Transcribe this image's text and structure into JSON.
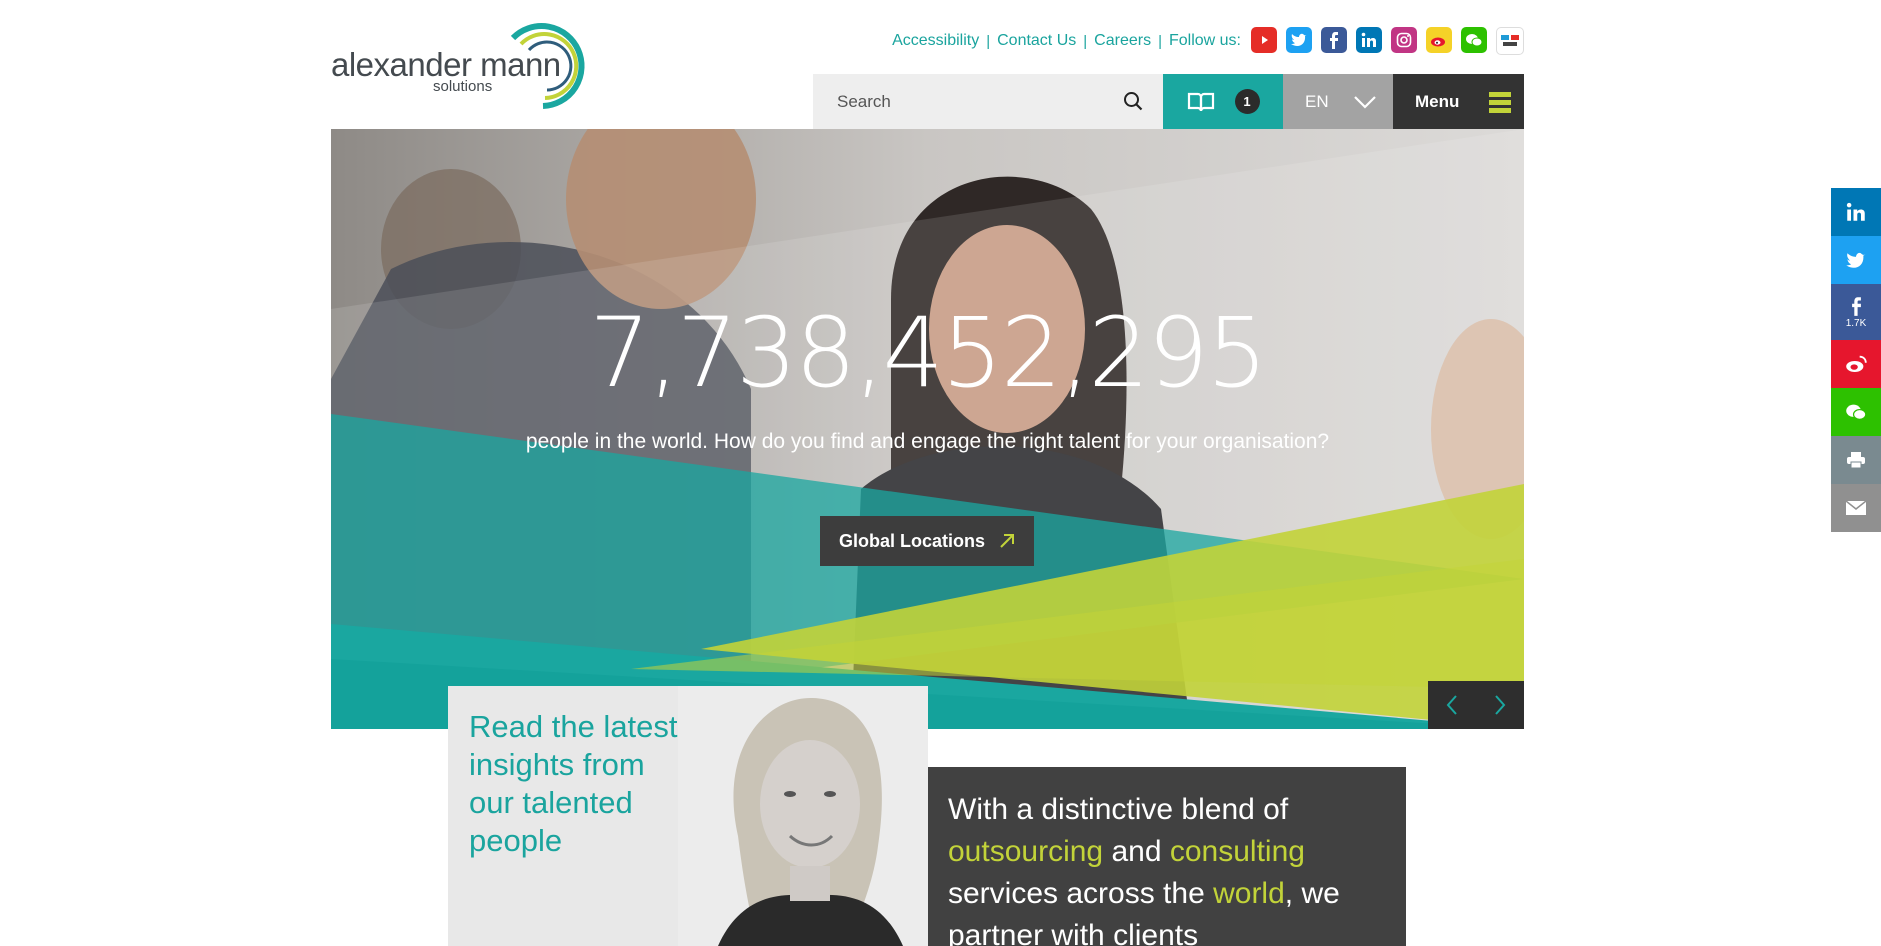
{
  "logo": {
    "name": "alexander mann",
    "sub": "solutions"
  },
  "top_links": {
    "accessibility": "Accessibility",
    "contact": "Contact Us",
    "careers": "Careers",
    "follow": "Follow us:"
  },
  "social": [
    {
      "icon": "youtube-icon",
      "color": "#e52d27"
    },
    {
      "icon": "twitter-icon",
      "color": "#1da1f2"
    },
    {
      "icon": "facebook-icon",
      "color": "#3b5998"
    },
    {
      "icon": "linkedin-icon",
      "color": "#0077b5"
    },
    {
      "icon": "instagram-icon",
      "color": "#c13584"
    },
    {
      "icon": "weibo-icon",
      "color": "#e6162d"
    },
    {
      "icon": "wechat-icon",
      "color": "#2dc100"
    },
    {
      "icon": "youku-icon",
      "color": "#1f9bd6"
    }
  ],
  "nav": {
    "search_placeholder": "Search",
    "bookmark_count": "1",
    "language": "EN",
    "menu_label": "Menu"
  },
  "hero": {
    "number": "7,738,452,295",
    "subtitle": "people in the world. How do you find and engage the right talent for your organisation?",
    "cta": "Global Locations"
  },
  "insight": {
    "text": "Read the latest insights from our talented people"
  },
  "blurb": {
    "part1": "With a distinctive blend of ",
    "highlight1": "outsourcing",
    "part2": " and ",
    "highlight2": "consulting",
    "part3": " services across the ",
    "highlight3": "world",
    "part4": ", we partner with clients"
  },
  "share_bar": {
    "facebook_count": "1.7K"
  },
  "colors": {
    "teal": "#1aa7a0",
    "lime": "#c2d339",
    "dark": "#333333",
    "grey": "#a3a3a3"
  }
}
